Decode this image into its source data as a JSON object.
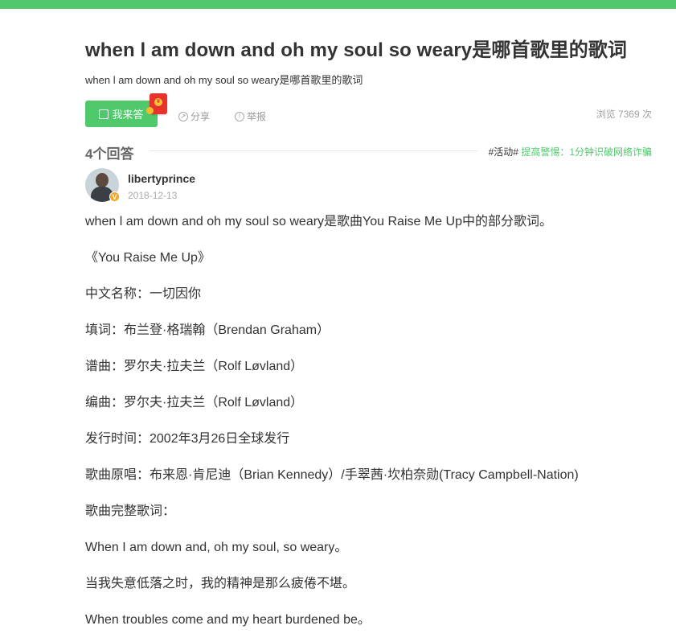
{
  "header": {
    "title": "when l am down and oh my soul so weary是哪首歌里的歌词",
    "subtitle": "when l am down and oh my soul so weary是哪首歌里的歌词"
  },
  "toolbar": {
    "answer_label": "我来答",
    "share_label": "分享",
    "report_label": "举报",
    "views_text": "浏览 7369 次"
  },
  "answers_section": {
    "count_label": "4个回答",
    "activity_tag": "#活动#",
    "activity_link": "提高警惕：1分钟识破网络诈骗"
  },
  "answer": {
    "username": "libertyprince",
    "date": "2018-12-13",
    "badge": "V",
    "paragraphs": [
      "when l am down and oh my soul so weary是歌曲You Raise Me Up中的部分歌词。",
      "《You Raise Me Up》",
      "中文名称：一切因你",
      "填词：布兰登·格瑞翰（Brendan Graham）",
      "谱曲：罗尔夫·拉夫兰（Rolf Løvland）",
      "编曲：罗尔夫·拉夫兰（Rolf Løvland）",
      "发行时间：2002年3月26日全球发行",
      "歌曲原唱：布来恩·肯尼迪（Brian Kennedy）/手翠茜·坎柏奈勋(Tracy Campbell-Nation)",
      "歌曲完整歌词：",
      "When I am down and, oh my soul, so weary。",
      "当我失意低落之时，我的精神是那么疲倦不堪。",
      "When troubles come and my heart burdened be。"
    ]
  },
  "colors": {
    "accent": "#4fc96c",
    "red_packet": "#e8322c"
  }
}
